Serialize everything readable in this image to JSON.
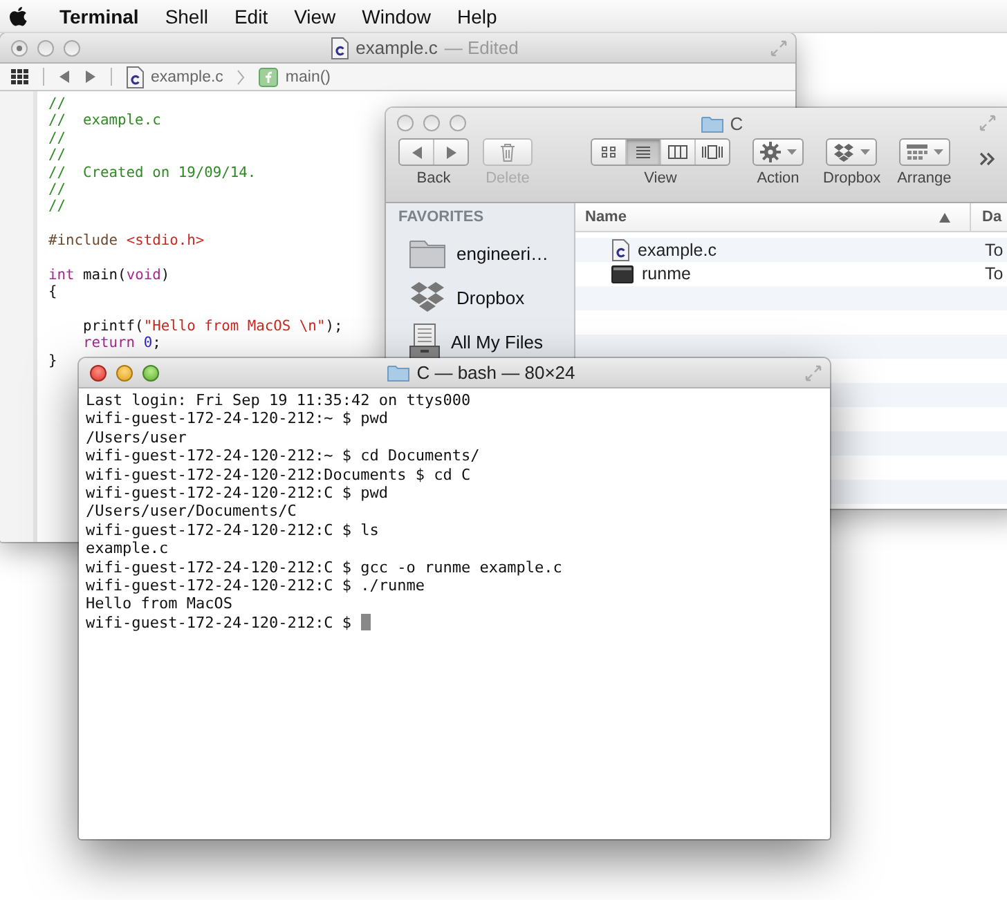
{
  "menu_bar": {
    "items": [
      {
        "label": "Terminal",
        "kind": "app"
      },
      {
        "label": "Shell",
        "kind": "menu"
      },
      {
        "label": "Edit",
        "kind": "menu"
      },
      {
        "label": "View",
        "kind": "menu"
      },
      {
        "label": "Window",
        "kind": "menu"
      },
      {
        "label": "Help",
        "kind": "menu"
      }
    ]
  },
  "editor_window": {
    "active": false,
    "edited": true,
    "title": "example.c",
    "status": "— Edited",
    "jump_bar": {
      "file": "example.c",
      "symbol": "main()"
    },
    "code_lines": [
      {
        "kind": "code",
        "tokens": [
          {
            "kind": "comment",
            "text": "//"
          }
        ]
      },
      {
        "kind": "code",
        "tokens": [
          {
            "kind": "comment",
            "text": "//  example.c"
          }
        ]
      },
      {
        "kind": "code",
        "tokens": [
          {
            "kind": "comment",
            "text": "//"
          }
        ]
      },
      {
        "kind": "code",
        "tokens": [
          {
            "kind": "comment",
            "text": "//"
          }
        ]
      },
      {
        "kind": "code",
        "tokens": [
          {
            "kind": "comment",
            "text": "//  Created on 19/09/14."
          }
        ]
      },
      {
        "kind": "code",
        "tokens": [
          {
            "kind": "comment",
            "text": "//"
          }
        ]
      },
      {
        "kind": "code",
        "tokens": [
          {
            "kind": "comment",
            "text": "//"
          }
        ]
      },
      {
        "kind": "blank"
      },
      {
        "kind": "code",
        "tokens": [
          {
            "kind": "preprocessor",
            "text": "#include "
          },
          {
            "kind": "string",
            "text": "<stdio.h>"
          }
        ]
      },
      {
        "kind": "blank"
      },
      {
        "kind": "code",
        "tokens": [
          {
            "kind": "keyword",
            "text": "int"
          },
          {
            "kind": "plain",
            "text": " main("
          },
          {
            "kind": "keyword",
            "text": "void"
          },
          {
            "kind": "plain",
            "text": ")"
          }
        ]
      },
      {
        "kind": "code",
        "tokens": [
          {
            "kind": "plain",
            "text": "{"
          }
        ]
      },
      {
        "kind": "blank"
      },
      {
        "kind": "code",
        "tokens": [
          {
            "kind": "plain",
            "text": "    printf("
          },
          {
            "kind": "string",
            "text": "\"Hello from MacOS \\n\""
          },
          {
            "kind": "plain",
            "text": ");"
          }
        ]
      },
      {
        "kind": "code",
        "tokens": [
          {
            "kind": "keyword",
            "text": "    return"
          },
          {
            "kind": "number",
            "text": " 0"
          },
          {
            "kind": "plain",
            "text": ";"
          }
        ]
      },
      {
        "kind": "code",
        "tokens": [
          {
            "kind": "plain",
            "text": "}"
          }
        ]
      }
    ]
  },
  "finder_window": {
    "active": false,
    "title": "C",
    "toolbar": [
      {
        "kind": "back-forward",
        "label": "Back",
        "disabled": false
      },
      {
        "kind": "delete",
        "label": "Delete",
        "disabled": true
      },
      {
        "kind": "view",
        "label": "View",
        "disabled": false,
        "segments": [
          {
            "kind": "icons",
            "selected": false
          },
          {
            "kind": "list",
            "selected": true
          },
          {
            "kind": "columns",
            "selected": false
          },
          {
            "kind": "coverflow",
            "selected": false
          }
        ]
      },
      {
        "kind": "action",
        "label": "Action",
        "disabled": false
      },
      {
        "kind": "dropbox",
        "label": "Dropbox",
        "disabled": false
      },
      {
        "kind": "arrange",
        "label": "Arrange",
        "disabled": false
      }
    ],
    "sidebar": {
      "heading": "FAVORITES",
      "items": [
        {
          "label": "engineeri…",
          "kind": "folder"
        },
        {
          "label": "Dropbox",
          "kind": "dropbox"
        },
        {
          "label": "All My Files",
          "kind": "all-files"
        }
      ]
    },
    "columns": [
      "Name",
      "Da"
    ],
    "rows": [
      {
        "name": "example.c",
        "column_2": "To",
        "kind": "c-source"
      },
      {
        "name": "runme",
        "column_2": "To",
        "kind": "executable"
      }
    ]
  },
  "terminal_window": {
    "active": true,
    "title": "C — bash — 80×24",
    "cursor": true,
    "lines": [
      "Last login: Fri Sep 19 11:35:42 on ttys000",
      "wifi-guest-172-24-120-212:~ $ pwd",
      "/Users/user",
      "wifi-guest-172-24-120-212:~ $ cd Documents/",
      "wifi-guest-172-24-120-212:Documents $ cd C",
      "wifi-guest-172-24-120-212:C $ pwd",
      "/Users/user/Documents/C",
      "wifi-guest-172-24-120-212:C $ ls",
      "example.c",
      "wifi-guest-172-24-120-212:C $ gcc -o runme example.c",
      "wifi-guest-172-24-120-212:C $ ./runme",
      "Hello from MacOS",
      "wifi-guest-172-24-120-212:C $ "
    ]
  }
}
